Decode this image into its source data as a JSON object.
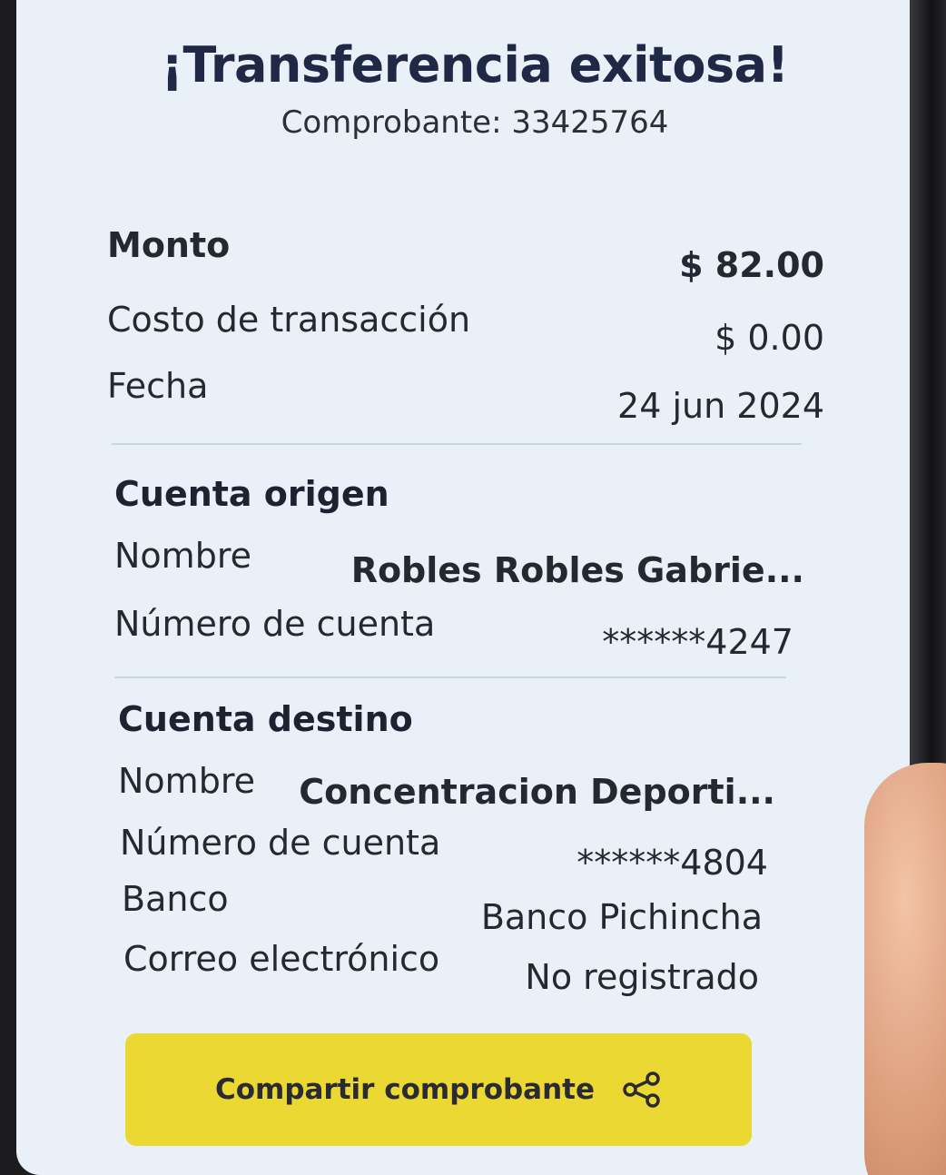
{
  "header": {
    "title": "¡Transferencia exitosa!",
    "receipt_label": "Comprobante: 33425764"
  },
  "summary": {
    "amount_label": "Monto",
    "amount_value": "$ 82.00",
    "fee_label": "Costo de transacción",
    "fee_value": "$ 0.00",
    "date_label": "Fecha",
    "date_value": "24 jun 2024"
  },
  "origin": {
    "section_title": "Cuenta origen",
    "name_label": "Nombre",
    "name_value": "Robles  Robles Gabrie...",
    "account_label": "Número de cuenta",
    "account_value": "******4247"
  },
  "destination": {
    "section_title": "Cuenta destino",
    "name_label": "Nombre",
    "name_value": "Concentracion Deporti...",
    "account_label": "Número de cuenta",
    "account_value": "******4804",
    "bank_label": "Banco",
    "bank_value": "Banco Pichincha",
    "email_label": "Correo electrónico",
    "email_value": "No registrado"
  },
  "actions": {
    "share_label": "Compartir comprobante",
    "share_icon": "share-icon"
  },
  "colors": {
    "background": "#e9f0f7",
    "title": "#1f2945",
    "button": "#ecd833"
  }
}
